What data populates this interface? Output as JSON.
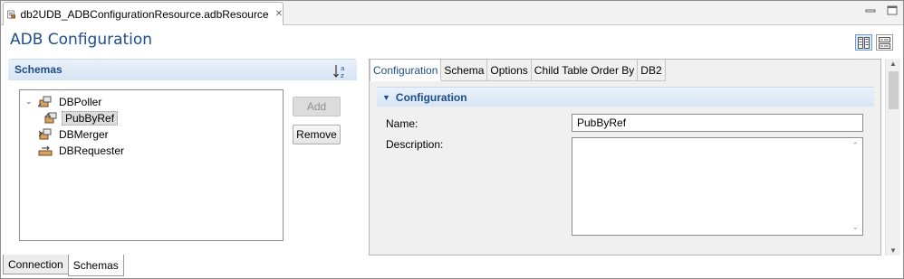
{
  "editor": {
    "tab_title": "db2UDB_ADBConfigurationResource.adbResource",
    "tab_icon": "resource-file-icon",
    "close_glyph": "✕"
  },
  "window": {
    "minimize_glyph": "—",
    "maximize_glyph": "☐"
  },
  "page": {
    "title": "ADB Configuration"
  },
  "schemas": {
    "title": "Schemas",
    "tree": [
      {
        "label": "DBPoller",
        "expanded": true,
        "icon": "poller-icon"
      },
      {
        "label": "PubByRef",
        "selected": true,
        "icon": "publisher-icon"
      },
      {
        "label": "DBMerger",
        "icon": "merger-icon"
      },
      {
        "label": "DBRequester",
        "icon": "requester-icon"
      }
    ],
    "add_label": "Add",
    "remove_label": "Remove"
  },
  "detail": {
    "tabs": [
      "Configuration",
      "Schema",
      "Options",
      "Child Table Order By",
      "DB2"
    ],
    "active_tab": "Configuration",
    "section_title": "Configuration",
    "name_label": "Name:",
    "name_value": "PubByRef",
    "description_label": "Description:",
    "description_value": ""
  },
  "bottom_tabs": [
    "Connection",
    "Schemas"
  ],
  "active_bottom_tab": "Schemas",
  "colors": {
    "accent": "#1f4d8a",
    "section_header": "#d6e4f3"
  }
}
